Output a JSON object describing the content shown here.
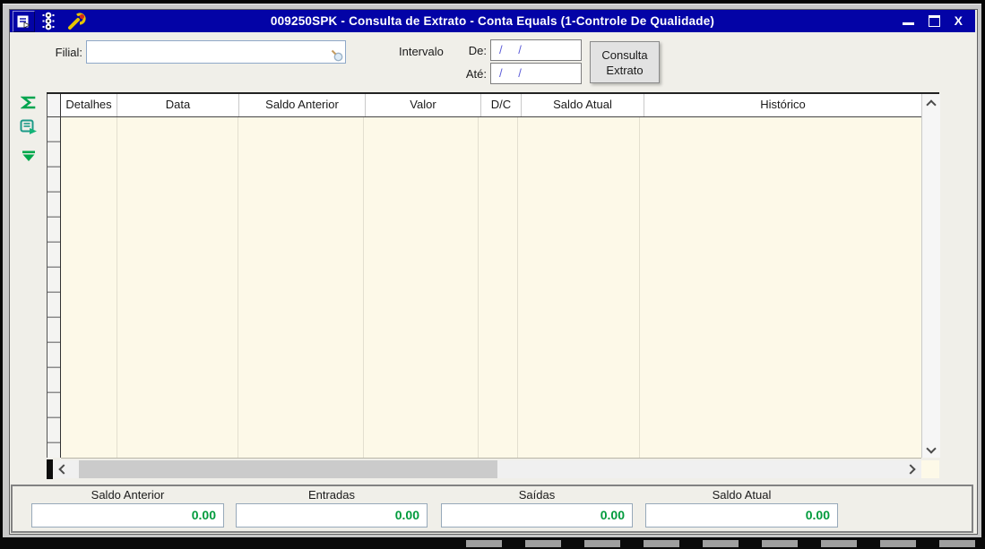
{
  "titlebar": {
    "title": "009250SPK - Consulta de Extrato - Conta Equals (1-Controle De Qualidade)",
    "close_label": "X",
    "icon_names": [
      "form-icon",
      "traffic-light-icon",
      "wrench-icon"
    ]
  },
  "toolbar": {
    "filial_label": "Filial:",
    "filial_value": "",
    "filial_icon": "magnifier-icon",
    "intervalo_label": "Intervalo",
    "de_label": "De:",
    "de_value": "/ /",
    "ate_label": "Até:",
    "ate_value": "/ /",
    "consulta_line1": "Consulta",
    "consulta_line2": "Extrato"
  },
  "sidebar": {
    "icon_names": [
      "sum-sigma-icon",
      "detail-form-icon",
      "go-to-end-icon"
    ]
  },
  "grid": {
    "columns": [
      "Detalhes",
      "Data",
      "Saldo Anterior",
      "Valor",
      "D/C",
      "Saldo Atual",
      "Histórico"
    ],
    "rows": []
  },
  "summary": {
    "items": [
      {
        "label": "Saldo Anterior",
        "value": "0.00"
      },
      {
        "label": "Entradas",
        "value": "0.00"
      },
      {
        "label": "Saídas",
        "value": "0.00"
      },
      {
        "label": "Saldo Atual",
        "value": "0.00"
      }
    ]
  },
  "colors": {
    "titlebar_blue": "#0303A6",
    "grid_body_cream": "#FDF9E8",
    "value_green": "#009B3C",
    "date_mask_blue": "#5C5CD8"
  }
}
